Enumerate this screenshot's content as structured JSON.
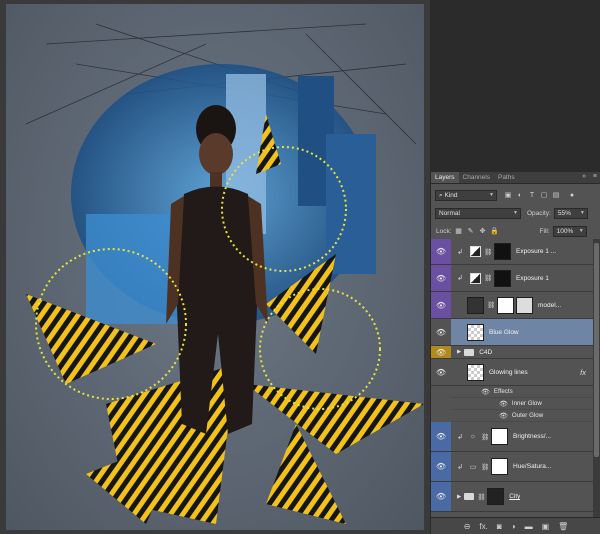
{
  "layers_panel": {
    "tabs": [
      {
        "label": "Layers",
        "active": true
      },
      {
        "label": "Channels",
        "active": false
      },
      {
        "label": "Paths",
        "active": false
      }
    ],
    "collapse_icon": "double-chevron-right-icon",
    "menu_icon": "panel-menu-icon",
    "filter": {
      "label": "Kind",
      "icon": "search-icon"
    },
    "filter_icons": [
      "image-filter-icon",
      "adjustment-filter-icon",
      "type-filter-icon",
      "shape-filter-icon",
      "smart-object-filter-icon",
      "filter-toggle-icon"
    ],
    "blend_mode": "Normal",
    "opacity_label": "Opacity:",
    "opacity_value": "55%",
    "lock_label": "Lock:",
    "lock_icons": [
      "lock-transparent-icon",
      "lock-brush-icon",
      "lock-move-icon",
      "lock-all-icon"
    ],
    "fill_label": "Fill:",
    "fill_value": "100%",
    "layers": [
      {
        "name": "Exposure 1 ...",
        "color": "#6b4fa0",
        "clipped": true,
        "kind": "adjustment",
        "selected": false
      },
      {
        "name": "Exposure 1",
        "color": "#6b4fa0",
        "clipped": true,
        "kind": "adjustment",
        "selected": false
      },
      {
        "name": "model...",
        "color": "#6b4fa0",
        "clipped": false,
        "kind": "smart",
        "selected": false
      },
      {
        "name": "Blue Glow",
        "color": "#6f85a6",
        "clipped": false,
        "kind": "pixel",
        "selected": true
      },
      {
        "name": "C4D",
        "color": "#b08a1e",
        "clipped": false,
        "kind": "group",
        "selected": false
      },
      {
        "name": "Glowing lines",
        "color": "#535353",
        "clipped": false,
        "kind": "pixel",
        "selected": false,
        "fx": "fx"
      },
      {
        "name": "Brightness/...",
        "color": "#4a6aa6",
        "clipped": true,
        "kind": "adjustment",
        "selected": false
      },
      {
        "name": "Hue/Satura...",
        "color": "#4a6aa6",
        "clipped": true,
        "kind": "adjustment",
        "selected": false
      },
      {
        "name": "City",
        "color": "#4a6aa6",
        "clipped": false,
        "kind": "group",
        "selected": false
      }
    ],
    "effects": {
      "label": "Effects",
      "items": [
        "Inner Glow",
        "Outer Glow"
      ]
    },
    "footer_icons": [
      "link-layers-icon",
      "add-style-icon",
      "add-mask-icon",
      "new-adjustment-icon",
      "new-group-icon",
      "new-layer-icon",
      "delete-layer-icon"
    ],
    "footer_glyphs": [
      "⊖",
      "fx.",
      "◙",
      "◑",
      "▬",
      "▣",
      "🗑"
    ]
  }
}
